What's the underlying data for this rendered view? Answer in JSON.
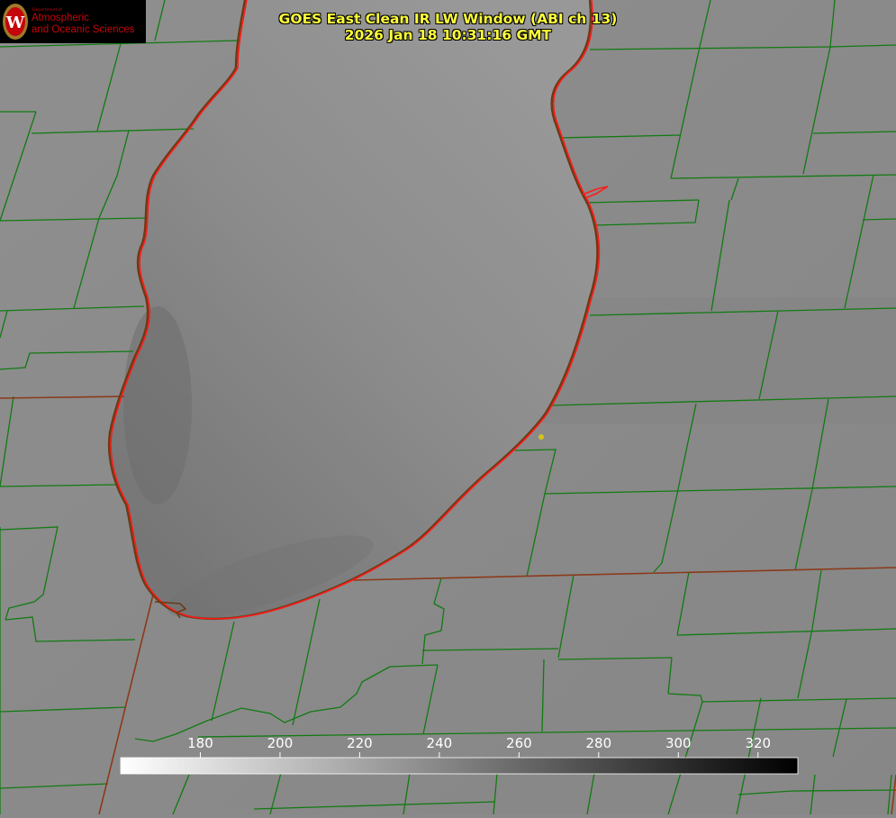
{
  "title": {
    "line1": "GOES East Clean IR LW Window (ABI ch 13)",
    "line2": "2026 Jan 18 10:31:16 GMT"
  },
  "logo": {
    "department": "Department of",
    "line1": "Atmospheric",
    "line2": "and Oceanic Sciences",
    "seal_letter": "W"
  },
  "colorbar": {
    "min": 160,
    "max": 330,
    "ticks": [
      "180",
      "200",
      "220",
      "240",
      "260",
      "280",
      "300",
      "320"
    ],
    "start_color": "#ffffff",
    "end_color": "#000000"
  },
  "colors": {
    "county_lines": "#127a12",
    "shoreline": "#ff1a1a",
    "state_lines": "#8b3a1a",
    "title_text": "#ffff3a",
    "marker": "#d6c21e"
  }
}
